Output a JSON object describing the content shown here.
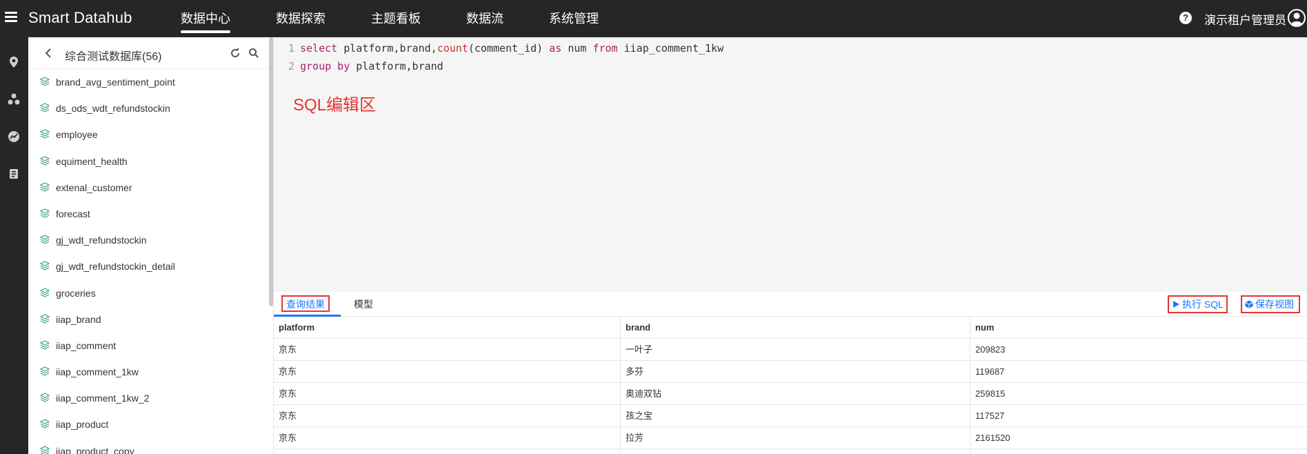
{
  "app": {
    "brand": "Smart Datahub"
  },
  "nav": {
    "items": [
      {
        "label": "数据中心"
      },
      {
        "label": "数据探索"
      },
      {
        "label": "主题看板"
      },
      {
        "label": "数据流"
      },
      {
        "label": "系统管理"
      }
    ],
    "active_index": 0
  },
  "header": {
    "username": "演示租户管理员",
    "help_icon": "help-icon",
    "avatar_icon": "user-avatar-icon"
  },
  "sidebar_icons": [
    "location-pin-icon",
    "cluster-icon",
    "chart-trend-icon",
    "report-icon"
  ],
  "table_panel": {
    "title": "综合测试数据库(56)",
    "tables": [
      "brand_avg_sentiment_point",
      "ds_ods_wdt_refundstockin",
      "employee",
      "equiment_health",
      "extenal_customer",
      "forecast",
      "gj_wdt_refundstockin",
      "gj_wdt_refundstockin_detail",
      "groceries",
      "iiap_brand",
      "iiap_comment",
      "iiap_comment_1kw",
      "iiap_comment_1kw_2",
      "iiap_product",
      "iiap_product_copy"
    ]
  },
  "editor": {
    "lines": [
      {
        "num": "1",
        "tokens": [
          {
            "t": "select",
            "c": "kw"
          },
          {
            "t": " platform,brand,",
            "c": "plain"
          },
          {
            "t": "count",
            "c": "fn"
          },
          {
            "t": "(comment_id) ",
            "c": "plain"
          },
          {
            "t": "as",
            "c": "kw"
          },
          {
            "t": " num ",
            "c": "plain"
          },
          {
            "t": "from",
            "c": "kw"
          },
          {
            "t": " iiap_comment_1kw",
            "c": "plain"
          }
        ]
      },
      {
        "num": "2",
        "tokens": [
          {
            "t": "group by",
            "c": "kw"
          },
          {
            "t": " platform,brand",
            "c": "plain"
          }
        ]
      }
    ],
    "annotation": "SQL编辑区"
  },
  "results": {
    "tabs": [
      {
        "label": "查询结果"
      },
      {
        "label": "模型"
      }
    ],
    "run_label": "执行 SQL",
    "save_label": "保存视图",
    "columns": [
      "platform",
      "brand",
      "num"
    ],
    "rows": [
      [
        "京东",
        "一叶子",
        "209823"
      ],
      [
        "京东",
        "多芬",
        "119687"
      ],
      [
        "京东",
        "奥迪双钻",
        "259815"
      ],
      [
        "京东",
        "孩之宝",
        "117527"
      ],
      [
        "京东",
        "拉芳",
        "2161520"
      ],
      [
        "",
        "",
        ""
      ]
    ]
  },
  "colors": {
    "topbar": "#262626",
    "accent": "#1677ff",
    "annotation_red": "#e53333"
  }
}
